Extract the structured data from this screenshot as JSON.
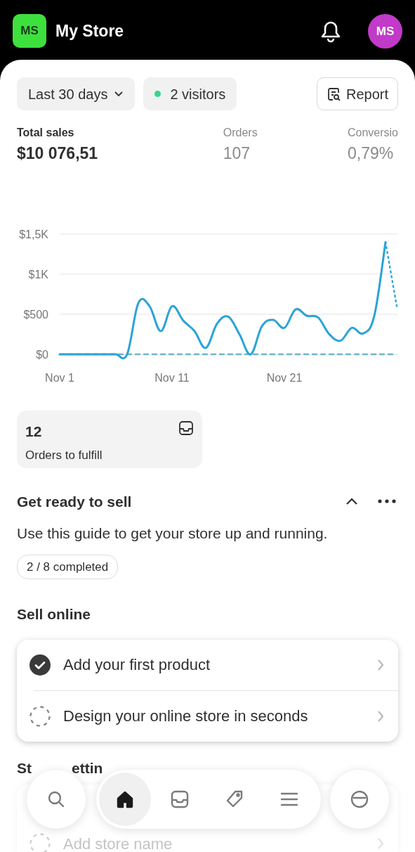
{
  "header": {
    "store_initials": "MS",
    "store_name": "My Store",
    "avatar_initials": "MS"
  },
  "filters": {
    "period": "Last 30 days",
    "visitors": "2 visitors",
    "report": "Report"
  },
  "metrics": [
    {
      "label": "Total sales",
      "value": "$10 076,51",
      "selected": true
    },
    {
      "label": "Orders",
      "value": "107",
      "selected": false
    },
    {
      "label": "Conversio",
      "value": "0,79%",
      "selected": false
    }
  ],
  "sales_chart": {
    "chart_data": {
      "type": "line",
      "categories": [
        "Nov 1",
        null,
        null,
        null,
        null,
        null,
        null,
        null,
        null,
        null,
        "Nov 11",
        null,
        null,
        null,
        null,
        null,
        null,
        null,
        null,
        null,
        "Nov 21",
        null,
        null,
        null,
        null,
        null,
        null,
        null,
        null,
        null,
        null
      ],
      "series": [
        {
          "color": "#6fb3c8",
          "line_style": "dashed",
          "values": [
            0,
            0,
            0,
            0,
            0,
            0,
            0,
            0,
            0,
            0,
            0,
            0,
            0,
            0,
            0,
            0,
            0,
            0,
            0,
            0,
            0,
            0,
            0,
            0,
            0,
            0,
            0,
            0,
            0,
            0,
            0
          ]
        },
        {
          "color": "#2ba3d8",
          "line_style": "solid",
          "values": [
            0,
            0,
            0,
            0,
            0,
            0,
            0,
            640,
            600,
            290,
            600,
            420,
            290,
            80,
            380,
            470,
            250,
            0,
            350,
            430,
            330,
            560,
            480,
            460,
            250,
            170,
            330,
            260,
            480,
            1400,
            null
          ]
        },
        {
          "color": "#2ba3d8",
          "line_style": "dotted",
          "values": [
            null,
            null,
            null,
            null,
            null,
            null,
            null,
            null,
            null,
            null,
            null,
            null,
            null,
            null,
            null,
            null,
            null,
            null,
            null,
            null,
            null,
            null,
            null,
            null,
            null,
            null,
            null,
            null,
            null,
            1400,
            600
          ]
        }
      ],
      "ylim": [
        0,
        1500
      ],
      "yticks": [
        {
          "value": 0,
          "label": "$0"
        },
        {
          "value": 500,
          "label": "$500"
        },
        {
          "value": 1000,
          "label": "$1K"
        },
        {
          "value": 1500,
          "label": "$1,5K"
        }
      ]
    }
  },
  "orders_card": {
    "count": "12",
    "label": "Orders to fulfill"
  },
  "guide": {
    "title": "Get ready to sell",
    "expanded": true,
    "description": "Use this guide to get your store up and running.",
    "progress": "2 / 8 completed"
  },
  "sections": [
    {
      "title_parts": [
        "Sell online"
      ],
      "faded": false,
      "tasks": [
        {
          "label": "Add your first product",
          "checked": true
        },
        {
          "label": "Design your online store in seconds",
          "checked": false
        }
      ]
    },
    {
      "title_parts": [
        "St",
        "ettin"
      ],
      "faded": true,
      "tasks": [
        {
          "label": "Add store name",
          "checked": false
        }
      ]
    }
  ],
  "bottom_nav": [
    {
      "kind": "search",
      "selected": false
    },
    {
      "kind": "home",
      "selected": true
    },
    {
      "kind": "orders",
      "selected": false
    },
    {
      "kind": "products",
      "selected": false
    },
    {
      "kind": "menu",
      "selected": false
    },
    {
      "kind": "assistant",
      "selected": false
    }
  ]
}
